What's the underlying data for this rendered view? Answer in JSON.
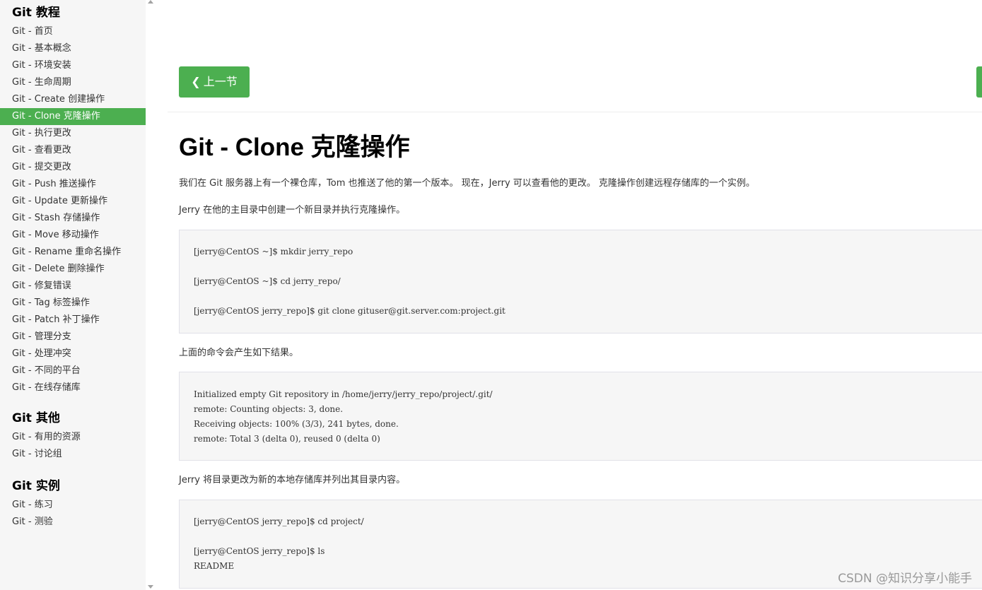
{
  "sidebar": {
    "sections": [
      {
        "title": "Git 教程",
        "items": [
          "Git - 首页",
          "Git - 基本概念",
          "Git - 环境安装",
          "Git - 生命周期",
          "Git - Create 创建操作",
          "Git - Clone 克隆操作",
          "Git - 执行更改",
          "Git - 查看更改",
          "Git - 提交更改",
          "Git - Push 推送操作",
          "Git - Update 更新操作",
          "Git - Stash 存储操作",
          "Git - Move 移动操作",
          "Git - Rename 重命名操作",
          "Git - Delete 删除操作",
          "Git - 修复错误",
          "Git - Tag 标签操作",
          "Git - Patch 补丁操作",
          "Git - 管理分支",
          "Git - 处理冲突",
          "Git - 不同的平台",
          "Git - 在线存储库"
        ]
      },
      {
        "title": "Git 其他",
        "items": [
          "Git - 有用的资源",
          "Git - 讨论组"
        ]
      },
      {
        "title": "Git 实例",
        "items": [
          "Git - 练习",
          "Git - 测验"
        ]
      }
    ],
    "active_item": "Git - Clone 克隆操作"
  },
  "nav": {
    "prev_label": "上一节",
    "prev_icon": "chevron-left-icon",
    "accent_color": "#4caf50"
  },
  "content": {
    "title": "Git - Clone 克隆操作",
    "intro": "我们在 Git 服务器上有一个裸仓库，Tom 也推送了他的第一个版本。 现在，Jerry 可以查看他的更改。 克隆操作创建远程存储库的一个实例。",
    "p2": "Jerry 在他的主目录中创建一个新目录并执行克隆操作。",
    "code1": [
      "[jerry@CentOS ~]$ mkdir jerry_repo",
      "[jerry@CentOS ~]$ cd jerry_repo/",
      "[jerry@CentOS jerry_repo]$ git clone gituser@git.server.com:project.git"
    ],
    "p3": "上面的命令会产生如下结果。",
    "code2": [
      "Initialized empty Git repository in /home/jerry/jerry_repo/project/.git/",
      "remote: Counting objects: 3, done.",
      "Receiving objects: 100% (3/3), 241 bytes, done.",
      "remote: Total 3 (delta 0), reused 0 (delta 0)"
    ],
    "p4": "Jerry 将目录更改为新的本地存储库并列出其目录内容。",
    "code3": [
      "[jerry@CentOS jerry_repo]$ cd project/",
      "[jerry@CentOS jerry_repo]$ ls",
      "README"
    ]
  },
  "watermark": "CSDN @知识分享小能手"
}
